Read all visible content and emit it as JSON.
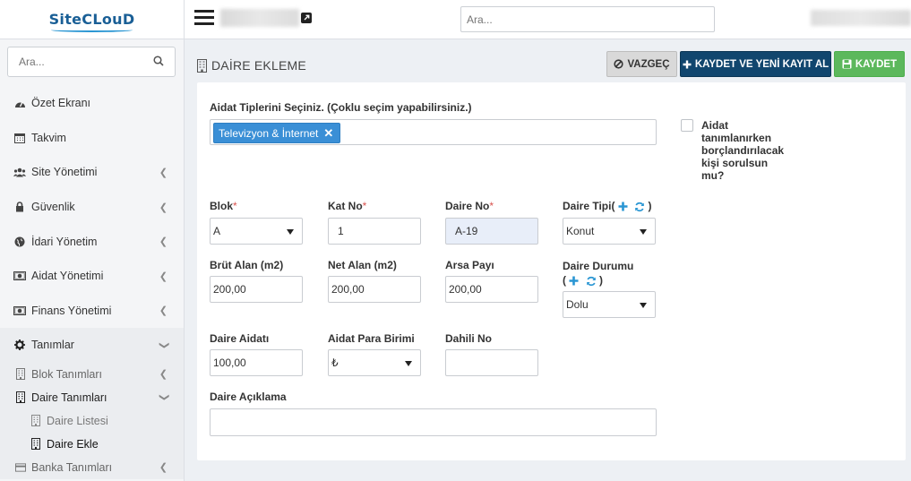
{
  "app": {
    "logo": "SiteCLouD"
  },
  "sidebar": {
    "search_placeholder": "Ara...",
    "menu": [
      {
        "label": "Özet Ekranı",
        "icon": "dashboard-icon"
      },
      {
        "label": "Takvim",
        "icon": "calendar-icon"
      },
      {
        "label": "Site Yönetimi",
        "icon": "users-icon"
      },
      {
        "label": "Güvenlik",
        "icon": "lock-icon"
      },
      {
        "label": "İdari Yönetim",
        "icon": "globe-icon"
      },
      {
        "label": "Aidat Yönetimi",
        "icon": "money-icon"
      },
      {
        "label": "Finans Yönetimi",
        "icon": "money-icon"
      },
      {
        "label": "Tanımlar",
        "icon": "gear-icon"
      }
    ],
    "sub_blok": "Blok Tanımları",
    "sub_daire": "Daire Tanımları",
    "subsub_liste": "Daire Listesi",
    "subsub_ekle": "Daire Ekle",
    "sub_banka": "Banka Tanımları"
  },
  "topbar": {
    "search_placeholder": "Ara..."
  },
  "page": {
    "title": "DAİRE EKLEME",
    "cancel_label": "VAZGEÇ",
    "save_new_label": "KAYDET VE YENİ KAYIT AL",
    "save_label": "KAYDET"
  },
  "form": {
    "dues_types_label": "Aidat Tiplerini Seçiniz. (Çoklu seçim yapabilirsiniz.)",
    "selected_tag": "Televizyon & İnternet",
    "dues_checkbox_label": "Aidat tanımlanırken borçlandırılacak kişi sorulsun mu?",
    "blok_label": "Blok",
    "blok_value": "A",
    "kat_label": "Kat No",
    "kat_value": "1",
    "daire_no_label": "Daire No",
    "daire_no_value": "A-19",
    "daire_tipi_label": "Daire Tipi(",
    "daire_tipi_close": ")",
    "daire_tipi_value": "Konut",
    "brut_label": "Brüt Alan (m2)",
    "brut_value": "200,00",
    "net_label": "Net Alan (m2)",
    "net_value": "200,00",
    "arsa_label": "Arsa Payı",
    "arsa_value": "200,00",
    "durum_label": "Daire Durumu",
    "durum_open": "(",
    "durum_close": ")",
    "durum_value": "Dolu",
    "aidat_label": "Daire Aidatı",
    "aidat_value": "100,00",
    "para_label": "Aidat Para Birimi",
    "para_value": "₺",
    "dahili_label": "Dahili No",
    "dahili_value": "",
    "aciklama_label": "Daire Açıklama",
    "required_mark": "*"
  },
  "colors": {
    "primary": "#11466e",
    "success": "#5cb85c",
    "tag": "#3a8fd6",
    "icon_blue": "#2a96d3"
  }
}
